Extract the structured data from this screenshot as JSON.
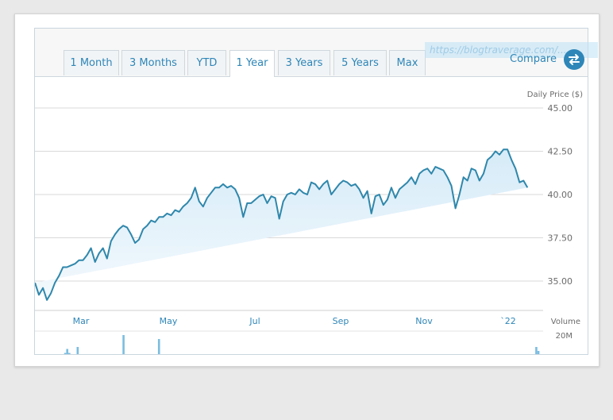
{
  "tabs": [
    {
      "label": "1 Month"
    },
    {
      "label": "3 Months"
    },
    {
      "label": "YTD"
    },
    {
      "label": "1 Year"
    },
    {
      "label": "3 Years"
    },
    {
      "label": "5 Years"
    },
    {
      "label": "Max"
    }
  ],
  "active_tab": "1 Year",
  "watermark": "https://blogtraverage.com/...",
  "compare_label": "Compare",
  "colors": {
    "line": "#2f87ab",
    "fill_top": "#d6ebf8",
    "volume": "#7bbde0",
    "accent": "#2e86b8"
  },
  "icons": {
    "compare": "swap-arrows-icon"
  },
  "chart_data": [
    {
      "type": "area",
      "ylabel": "Daily Price ($)",
      "yticks": [
        35.0,
        37.5,
        40.0,
        42.5,
        45.0
      ],
      "ylim": [
        33.3,
        45.0
      ],
      "xlabels": [
        "Mar",
        "May",
        "Jul",
        "Sep",
        "Nov",
        "`22"
      ],
      "grid": true,
      "x": [
        0,
        2,
        4,
        6,
        8,
        10,
        12,
        14,
        16,
        18,
        20,
        22,
        24,
        26,
        28,
        30,
        32,
        34,
        36,
        38,
        40,
        42,
        44,
        46,
        48,
        50,
        52,
        54,
        56,
        58,
        60,
        62,
        64,
        66,
        68,
        70,
        72,
        74,
        76,
        78,
        80,
        82,
        84,
        86,
        88,
        90,
        92,
        94,
        96,
        98,
        100,
        102,
        104,
        106,
        108,
        110,
        112,
        114,
        116,
        118,
        120,
        122,
        124,
        126,
        128,
        130,
        132,
        134,
        136,
        138,
        140,
        142,
        144,
        146,
        148,
        150,
        152,
        154,
        156,
        158,
        160,
        162,
        164,
        166,
        168,
        170,
        172,
        174,
        176,
        178,
        180,
        182,
        184,
        186,
        188,
        190,
        192,
        194,
        196,
        198,
        200,
        202,
        204,
        206,
        208,
        210,
        212,
        214,
        216,
        218,
        220,
        222,
        224,
        226,
        228,
        230,
        232,
        234,
        236,
        238,
        240,
        242,
        244,
        246,
        248,
        250,
        252,
        253
      ],
      "values": [
        34.9,
        34.2,
        34.6,
        33.9,
        34.3,
        34.9,
        35.3,
        35.8,
        35.8,
        35.9,
        36.0,
        36.2,
        36.2,
        36.5,
        36.9,
        36.1,
        36.6,
        36.9,
        36.3,
        37.3,
        37.7,
        38.0,
        38.2,
        38.1,
        37.7,
        37.2,
        37.4,
        38.0,
        38.2,
        38.5,
        38.4,
        38.7,
        38.7,
        38.9,
        38.8,
        39.1,
        39.0,
        39.3,
        39.5,
        39.8,
        40.4,
        39.6,
        39.3,
        39.8,
        40.1,
        40.4,
        40.4,
        40.6,
        40.4,
        40.5,
        40.3,
        39.8,
        38.7,
        39.5,
        39.5,
        39.7,
        39.9,
        40.0,
        39.5,
        39.9,
        39.8,
        38.6,
        39.6,
        40.0,
        40.1,
        40.0,
        40.3,
        40.1,
        40.0,
        40.7,
        40.6,
        40.3,
        40.6,
        40.8,
        40.0,
        40.3,
        40.6,
        40.8,
        40.7,
        40.5,
        40.6,
        40.3,
        39.8,
        40.2,
        38.9,
        39.9,
        40.0,
        39.4,
        39.7,
        40.4,
        39.8,
        40.3,
        40.5,
        40.7,
        41.0,
        40.6,
        41.2,
        41.4,
        41.5,
        41.2,
        41.6,
        41.5,
        41.4,
        41.0,
        40.5,
        39.2,
        40.0,
        41.0,
        40.8,
        41.5,
        41.4,
        40.8,
        41.2,
        42.0,
        42.2,
        42.5,
        42.3,
        42.6,
        42.6,
        42.0,
        41.5,
        40.7,
        40.8,
        40.4
      ]
    },
    {
      "type": "bar",
      "ylabel": "Volume",
      "yticks_labels": [
        "20M"
      ],
      "ylim": [
        0,
        20
      ],
      "values": [
        4,
        4,
        5,
        3,
        3,
        3,
        2,
        3,
        3,
        5,
        4,
        4,
        4,
        6,
        9,
        11,
        9,
        6,
        5,
        6,
        12,
        6,
        6,
        5,
        5,
        6,
        4,
        5,
        5,
        4,
        5,
        4,
        4,
        4,
        4,
        5,
        4,
        4,
        7,
        5,
        4,
        5,
        18,
        6,
        4,
        5,
        4,
        4,
        6,
        4,
        3,
        3,
        5,
        3,
        7,
        5,
        6,
        4,
        5,
        16,
        4,
        4,
        5,
        6,
        4,
        6,
        3,
        5,
        7,
        4,
        5,
        4,
        3,
        3,
        4,
        5,
        4,
        3,
        3,
        4,
        3,
        4,
        4,
        5,
        3,
        4,
        3,
        3,
        4,
        4,
        3,
        4,
        3,
        3,
        4,
        5,
        3,
        4,
        3,
        3,
        4,
        3,
        3,
        4,
        3,
        5,
        3,
        3,
        4,
        3,
        3,
        5,
        3,
        3,
        3,
        3,
        4,
        3,
        3,
        4,
        4,
        5,
        3,
        3,
        5,
        8,
        5,
        4,
        4,
        4,
        3,
        4,
        4,
        4,
        3,
        3,
        4,
        5,
        3,
        3,
        6,
        4,
        4,
        3,
        3,
        4,
        3,
        3,
        3,
        4,
        3,
        3,
        3,
        4,
        3,
        3,
        3,
        4,
        3,
        3,
        3,
        3,
        3,
        4,
        3,
        3,
        4,
        3,
        5,
        3,
        3,
        4,
        3,
        3,
        3,
        3,
        5,
        3,
        3,
        4,
        3,
        3,
        3,
        4,
        3,
        3,
        3,
        4,
        6,
        3,
        4,
        3,
        3,
        4,
        3,
        3,
        3,
        3,
        4,
        3,
        3,
        4,
        3,
        3,
        3,
        3,
        4,
        3,
        4,
        3,
        3,
        3,
        4,
        3,
        3,
        3,
        3,
        5,
        3,
        3,
        3,
        3,
        4,
        3,
        3,
        3,
        3,
        4,
        3,
        3,
        4,
        3,
        3,
        3,
        3,
        4,
        3,
        3,
        4,
        8,
        12,
        10,
        6
      ]
    }
  ]
}
